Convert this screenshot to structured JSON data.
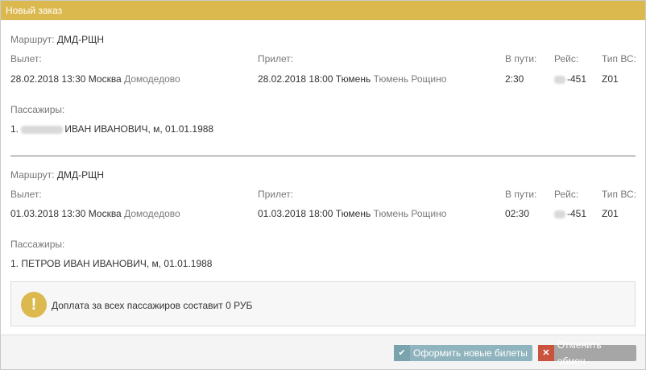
{
  "dialog": {
    "title": "Новый заказ"
  },
  "labels": {
    "route": "Маршрут:",
    "departure": "Вылет:",
    "arrival": "Прилет:",
    "in_transit": "В пути:",
    "flight": "Рейс:",
    "aircraft_type": "Тип ВС:",
    "passengers": "Пассажиры:"
  },
  "segments": [
    {
      "route": "ДМД-РЩН",
      "departure": {
        "datetime": "28.02.2018  13:30",
        "city": "Москва",
        "airport": "Домодедово"
      },
      "arrival": {
        "datetime": "28.02.2018  18:00",
        "city": "Тюмень",
        "airport": "Тюмень Рощино"
      },
      "duration": "2:30",
      "flight_number": "-451",
      "aircraft": "Z01",
      "passengers": [
        {
          "index": "1.",
          "text": "ИВАН ИВАНОВИЧ, м, 01.01.1988"
        }
      ]
    },
    {
      "route": "ДМД-РЩН",
      "departure": {
        "datetime": "01.03.2018  13:30",
        "city": "Москва",
        "airport": "Домодедово"
      },
      "arrival": {
        "datetime": "01.03.2018  18:00",
        "city": "Тюмень",
        "airport": "Тюмень Рощино"
      },
      "duration": "02:30",
      "flight_number": "-451",
      "aircraft": "Z01",
      "passengers": [
        {
          "index": "1.",
          "text": "ПЕТРОВ ИВАН ИВАНОВИЧ, м, 01.01.1988"
        }
      ]
    }
  ],
  "notice": {
    "icon": "exclamation-icon",
    "text": "Доплата за всех пассажиров составит  0 РУБ"
  },
  "footer": {
    "issue_button": "Оформить новые билеты",
    "cancel_button": "Отменить обмен"
  },
  "colors": {
    "header": "#dcb94f",
    "issue_button": "#8fb4bd",
    "cancel_button": "#a6a6a6",
    "cancel_icon": "#c9533c"
  }
}
